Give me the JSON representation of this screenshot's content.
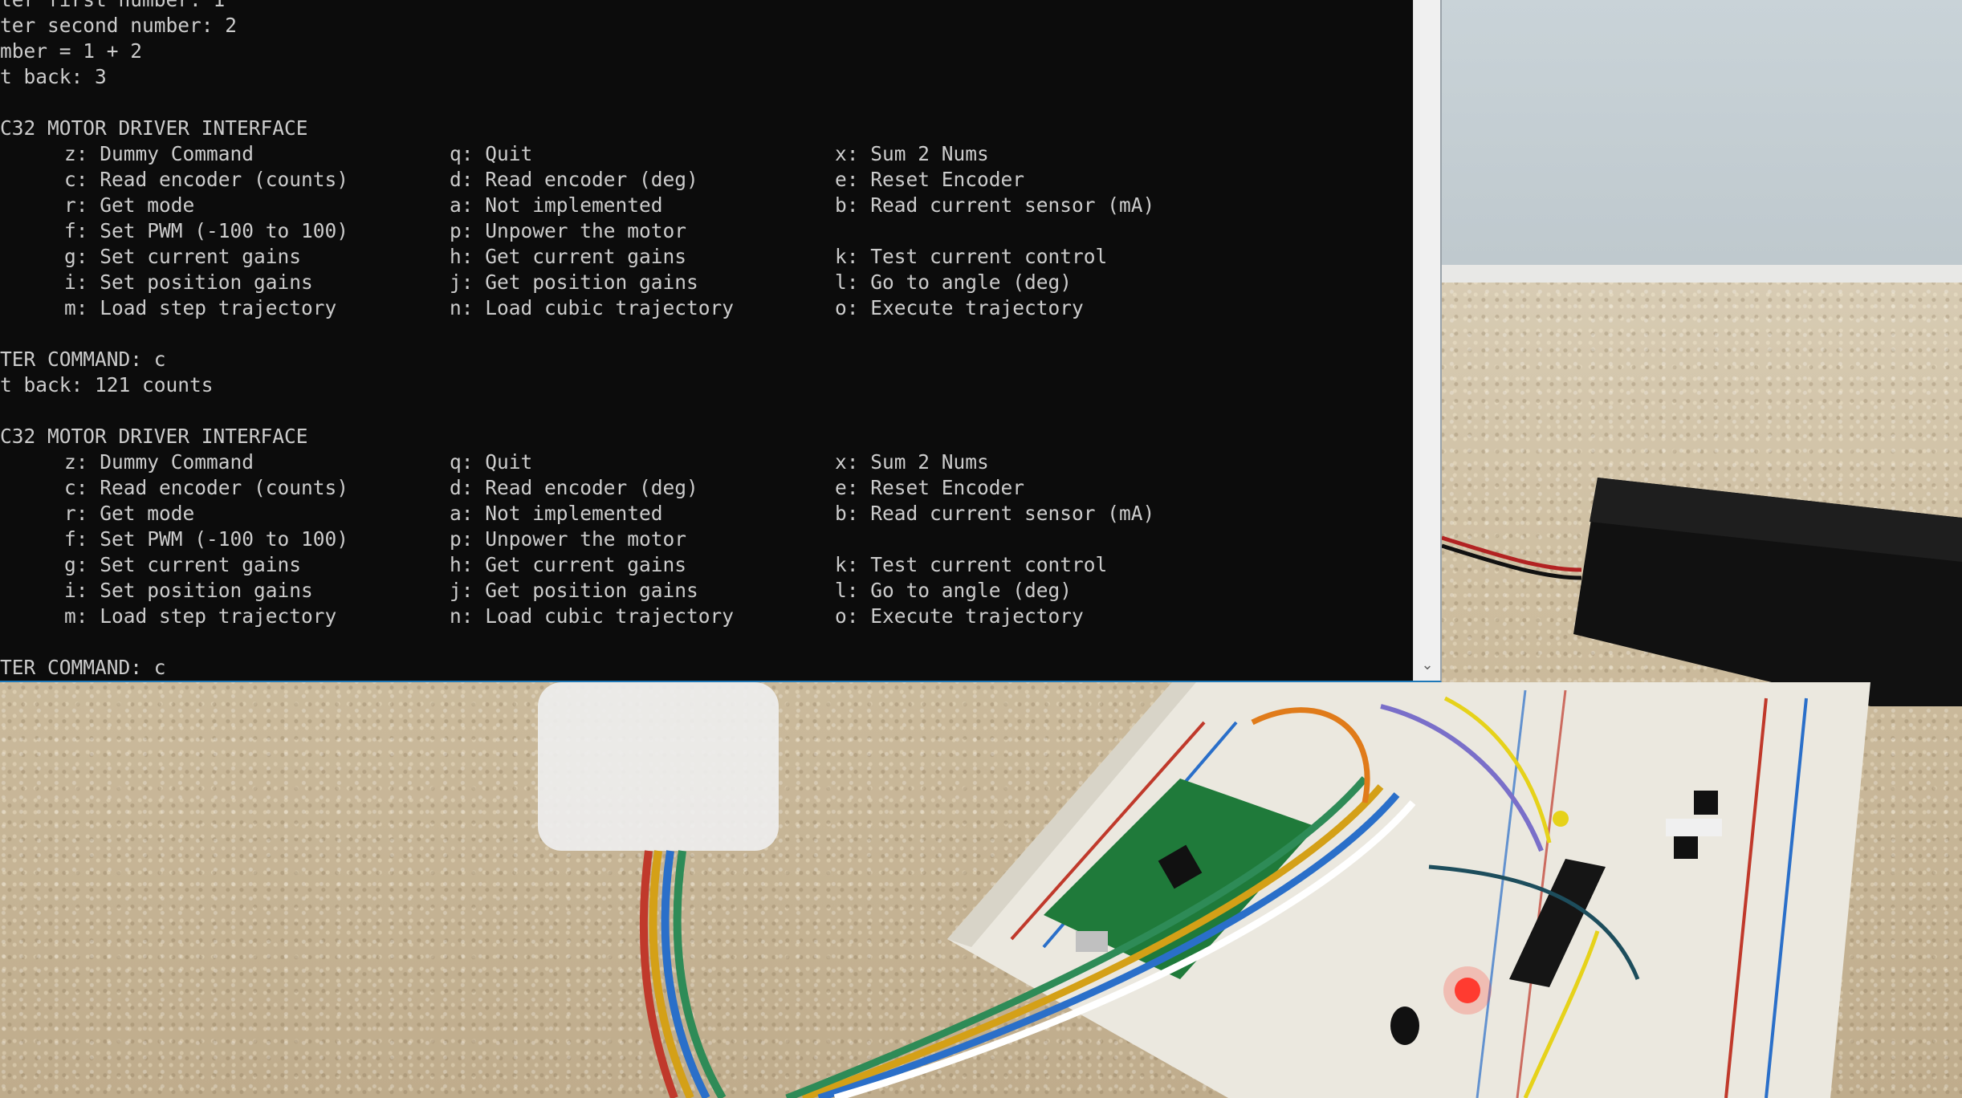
{
  "terminal": {
    "lines": [
      {
        "kind": "text",
        "text": "ter first number: 1"
      },
      {
        "kind": "text",
        "text": "ter second number: 2"
      },
      {
        "kind": "text",
        "text": "mber = 1 + 2"
      },
      {
        "kind": "text",
        "text": "t back: 3"
      },
      {
        "kind": "blank",
        "text": ""
      },
      {
        "kind": "text",
        "text": "C32 MOTOR DRIVER INTERFACE"
      },
      {
        "kind": "menu",
        "c1": "z: Dummy Command",
        "c2": "q: Quit",
        "c3": "x: Sum 2 Nums"
      },
      {
        "kind": "menu",
        "c1": "c: Read encoder (counts)",
        "c2": "d: Read encoder (deg)",
        "c3": "e: Reset Encoder"
      },
      {
        "kind": "menu",
        "c1": "r: Get mode",
        "c2": "a: Not implemented",
        "c3": "b: Read current sensor (mA)"
      },
      {
        "kind": "menu",
        "c1": "f: Set PWM (-100 to 100)",
        "c2": "p: Unpower the motor",
        "c3": ""
      },
      {
        "kind": "menu",
        "c1": "g: Set current gains",
        "c2": "h: Get current gains",
        "c3": "k: Test current control"
      },
      {
        "kind": "menu",
        "c1": "i: Set position gains",
        "c2": "j: Get position gains",
        "c3": "l: Go to angle (deg)"
      },
      {
        "kind": "menu",
        "c1": "m: Load step trajectory",
        "c2": "n: Load cubic trajectory",
        "c3": "o: Execute trajectory"
      },
      {
        "kind": "blank",
        "text": ""
      },
      {
        "kind": "text",
        "text": "TER COMMAND: c"
      },
      {
        "kind": "text",
        "text": "t back: 121 counts"
      },
      {
        "kind": "blank",
        "text": ""
      },
      {
        "kind": "text",
        "text": "C32 MOTOR DRIVER INTERFACE"
      },
      {
        "kind": "menu",
        "c1": "z: Dummy Command",
        "c2": "q: Quit",
        "c3": "x: Sum 2 Nums"
      },
      {
        "kind": "menu",
        "c1": "c: Read encoder (counts)",
        "c2": "d: Read encoder (deg)",
        "c3": "e: Reset Encoder"
      },
      {
        "kind": "menu",
        "c1": "r: Get mode",
        "c2": "a: Not implemented",
        "c3": "b: Read current sensor (mA)"
      },
      {
        "kind": "menu",
        "c1": "f: Set PWM (-100 to 100)",
        "c2": "p: Unpower the motor",
        "c3": ""
      },
      {
        "kind": "menu",
        "c1": "g: Set current gains",
        "c2": "h: Get current gains",
        "c3": "k: Test current control"
      },
      {
        "kind": "menu",
        "c1": "i: Set position gains",
        "c2": "j: Get position gains",
        "c3": "l: Go to angle (deg)"
      },
      {
        "kind": "menu",
        "c1": "m: Load step trajectory",
        "c2": "n: Load cubic trajectory",
        "c3": "o: Execute trajectory"
      },
      {
        "kind": "blank",
        "text": ""
      },
      {
        "kind": "text",
        "text": "TER COMMAND: c"
      }
    ],
    "scroll_down_icon": "chevron-down-icon"
  },
  "colors": {
    "terminal_bg": "#0c0c0c",
    "terminal_text": "#cccccc",
    "window_border": "#1e78b8",
    "led_red": "#ff3b30",
    "pcb_green": "#1f7a3a"
  }
}
